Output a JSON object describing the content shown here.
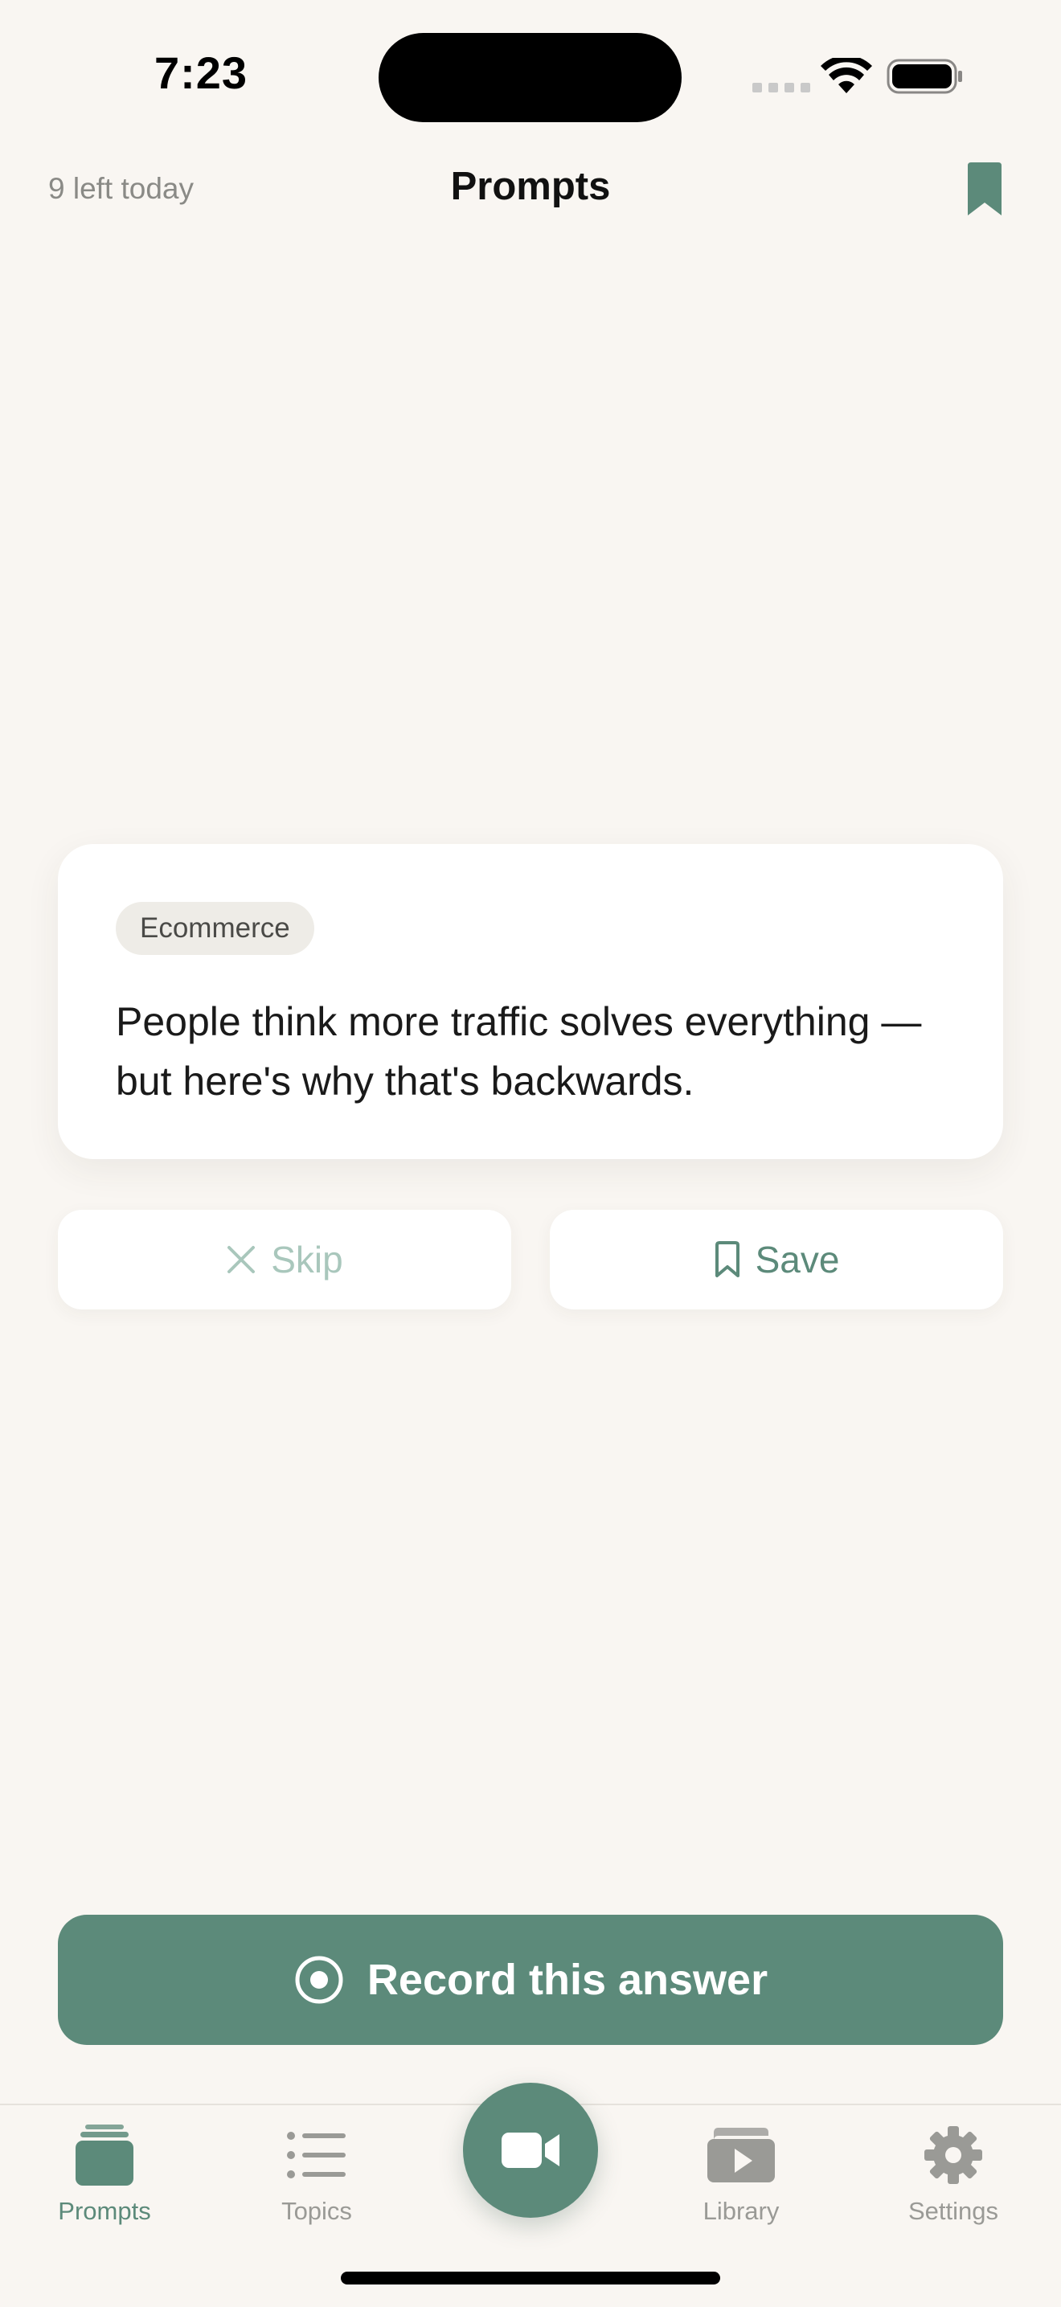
{
  "status_bar": {
    "time": "7:23",
    "icons": [
      "signal-icon",
      "wifi-icon",
      "battery-icon"
    ]
  },
  "header": {
    "left_text": "9 left today",
    "title": "Prompts",
    "right_icon": "bookmark-icon"
  },
  "card": {
    "category": "Ecommerce",
    "prompt": "People think more traffic solves everything — but here's why that's backwards."
  },
  "actions": {
    "skip_label": "Skip",
    "skip_icon": "x-icon",
    "save_label": "Save",
    "save_icon": "bookmark-outline-icon"
  },
  "record_button": {
    "label": "Record this answer",
    "icon": "record-circle-icon"
  },
  "tab_bar": {
    "tabs": [
      {
        "label": "Prompts",
        "icon": "stack-icon",
        "active": true
      },
      {
        "label": "Topics",
        "icon": "list-icon",
        "active": false
      },
      {
        "label": "Library",
        "icon": "video-library-icon",
        "active": false
      },
      {
        "label": "Settings",
        "icon": "gear-icon",
        "active": false
      }
    ],
    "center_icon": "video-camera-icon"
  },
  "colors": {
    "accent": "#5c8a7a",
    "background": "#f9f6f2",
    "card": "#ffffff",
    "chip": "#eeece7",
    "muted_text": "#8a8a86",
    "skip_text": "#a9c7bc"
  }
}
